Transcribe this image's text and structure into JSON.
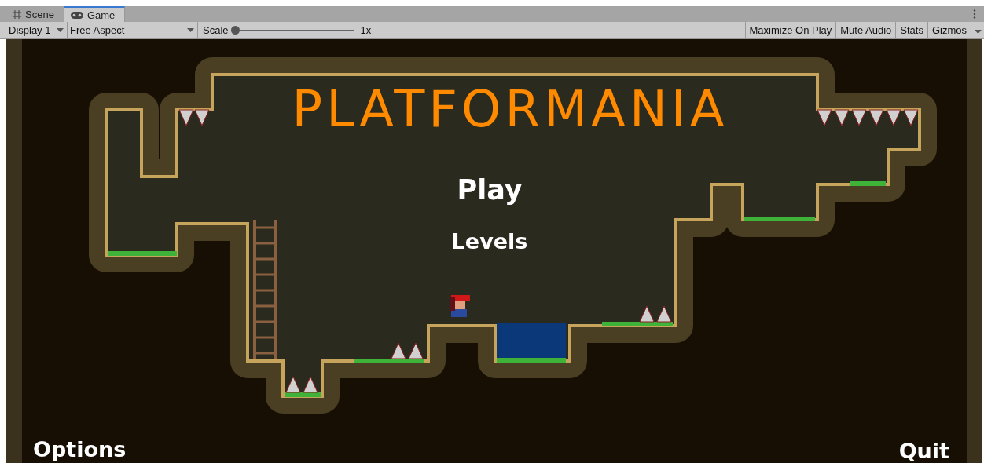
{
  "tabs": [
    {
      "label": "Scene",
      "kind": "scene",
      "selected": false
    },
    {
      "label": "Game",
      "kind": "game",
      "selected": true
    }
  ],
  "toolbar": {
    "display": "Display 1",
    "aspect": "Free Aspect",
    "scale_label": "Scale",
    "scale": {
      "level": 0
    },
    "scale_reading": "1x",
    "toggles": [
      "Maximize On Play",
      "Mute Audio",
      "Stats",
      "Gizmos"
    ]
  },
  "game": {
    "title": "PLATFORMANIA",
    "menu": [
      {
        "label": "Play",
        "kind": "main"
      },
      {
        "label": "Levels",
        "kind": "sub"
      },
      {
        "label": "Options",
        "kind": "corner-left"
      },
      {
        "label": "Quit",
        "kind": "corner-right"
      }
    ]
  }
}
